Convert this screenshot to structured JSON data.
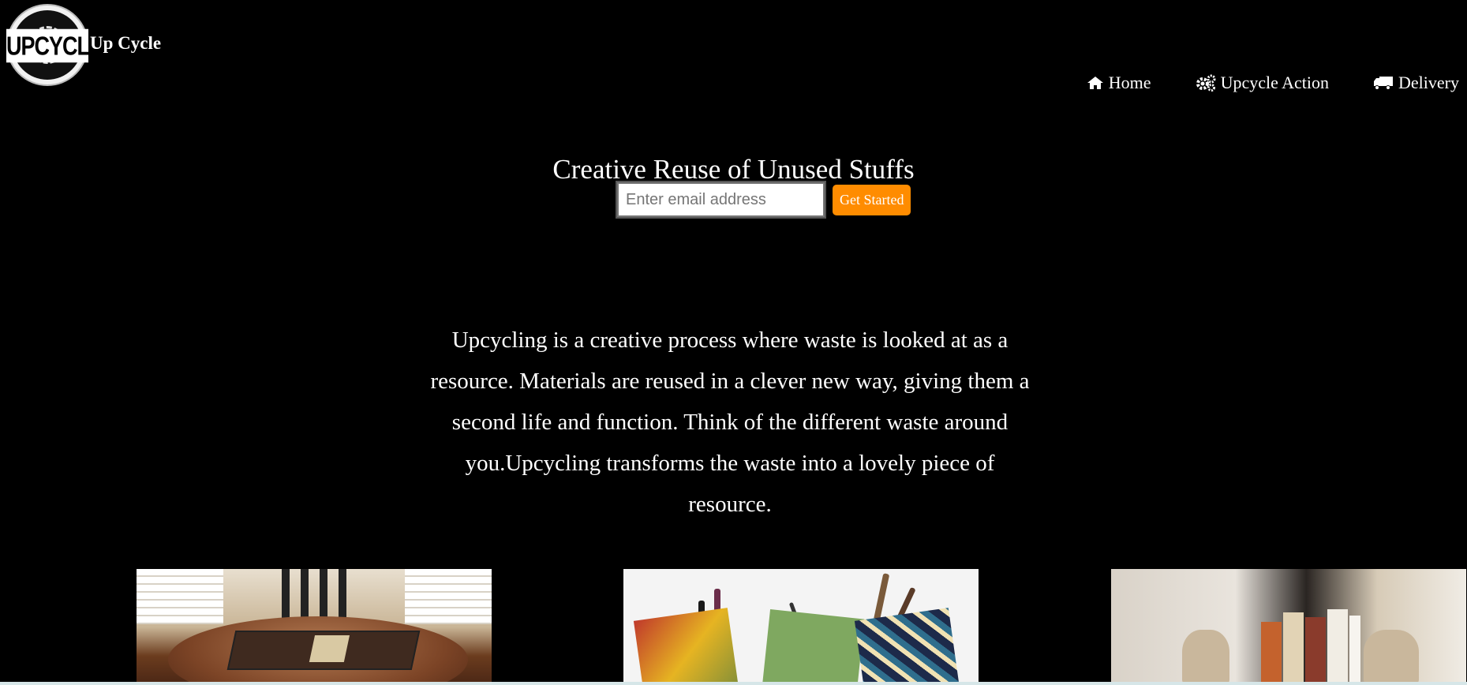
{
  "header": {
    "logo_text": "UPCYCLE",
    "brand_name": "Up Cycle"
  },
  "nav": {
    "items": [
      {
        "label": "Home",
        "icon": "home-icon"
      },
      {
        "label": "Upcycle Action",
        "icon": "gears-icon"
      },
      {
        "label": "Delivery",
        "icon": "truck-icon"
      }
    ]
  },
  "hero": {
    "title": "Creative Reuse of Unused Stuffs",
    "email_placeholder": "Enter email address",
    "email_value": "",
    "cta_label": "Get Started",
    "cta_color": "#ff8c00"
  },
  "description": "Upcycling is a creative process where waste is looked at as a resource. Materials are reused in a clever new way, giving them a second life and function. Think of the different waste around you.Upcycling transforms the waste into a lovely piece of resource.",
  "gallery": {
    "images": [
      {
        "subject": "upcycled-table-photo"
      },
      {
        "subject": "fabric-pen-holders-photo"
      },
      {
        "subject": "book-shelf-photo"
      }
    ]
  },
  "colors": {
    "background": "#000000",
    "text": "#ffffff",
    "accent": "#ff8c00"
  }
}
